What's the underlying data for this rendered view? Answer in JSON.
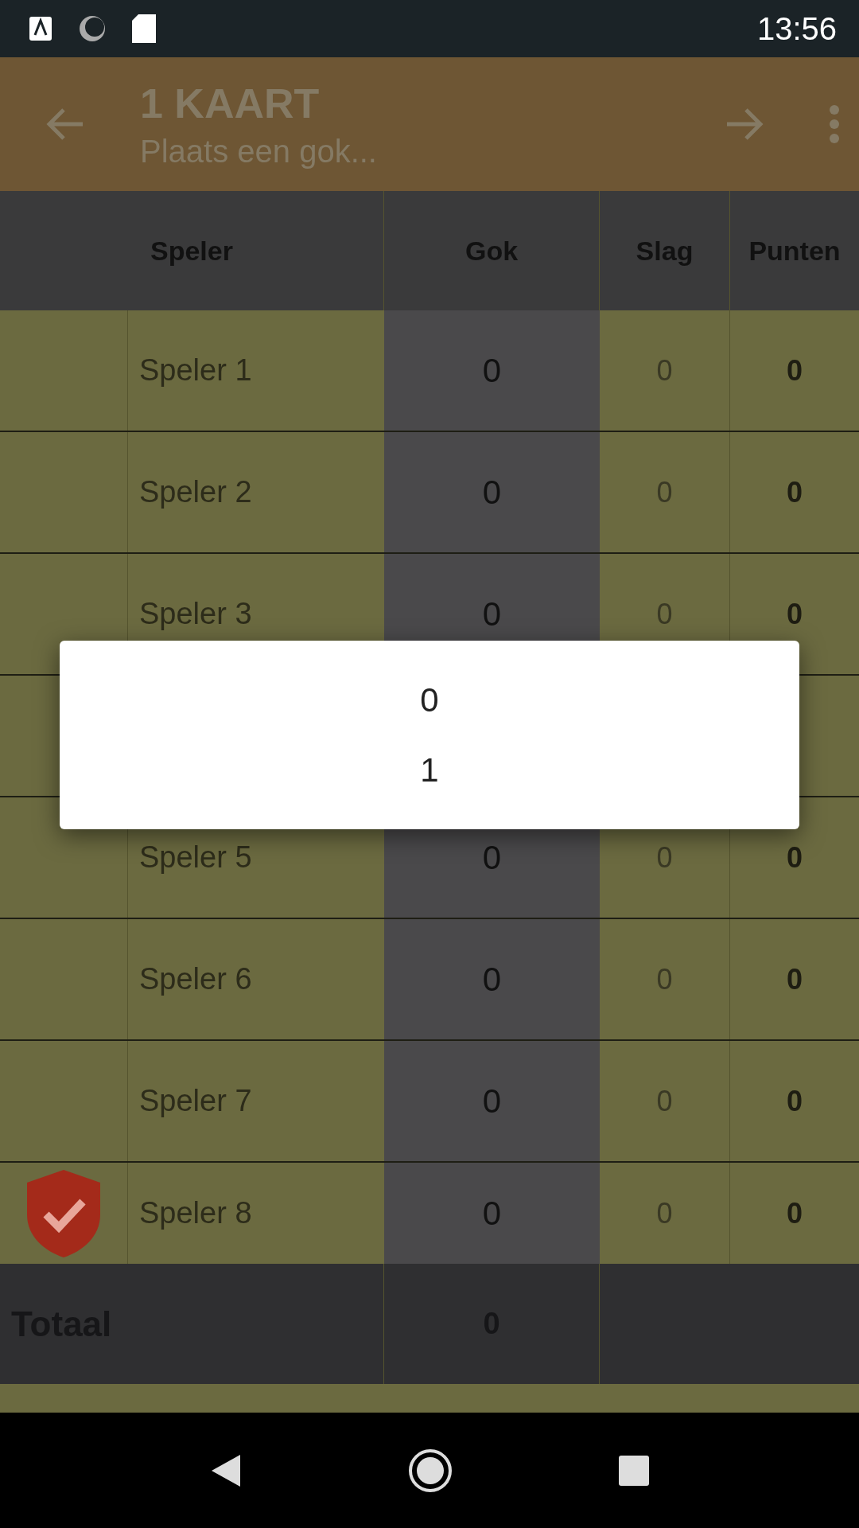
{
  "status_bar": {
    "time": "13:56"
  },
  "app_bar": {
    "title": "1 KAART",
    "subtitle": "Plaats een gok..."
  },
  "table": {
    "columns": [
      "Speler",
      "Gok",
      "Slag",
      "Punten"
    ],
    "rows": [
      {
        "name": "Speler 1",
        "gok": "0",
        "slag": "0",
        "punten": "0",
        "dealer": false
      },
      {
        "name": "Speler 2",
        "gok": "0",
        "slag": "0",
        "punten": "0",
        "dealer": false
      },
      {
        "name": "Speler 3",
        "gok": "0",
        "slag": "0",
        "punten": "0",
        "dealer": false
      },
      {
        "hidden": true
      },
      {
        "name": "Speler 5",
        "gok": "0",
        "slag": "0",
        "punten": "0",
        "dealer": false
      },
      {
        "name": "Speler 6",
        "gok": "0",
        "slag": "0",
        "punten": "0",
        "dealer": false
      },
      {
        "name": "Speler 7",
        "gok": "0",
        "slag": "0",
        "punten": "0",
        "dealer": false
      },
      {
        "name": "Speler 8",
        "gok": "0",
        "slag": "0",
        "punten": "0",
        "dealer": true
      }
    ],
    "total": {
      "label": "Totaal",
      "gok": "0"
    }
  },
  "dialog": {
    "options": [
      "0",
      "1"
    ]
  }
}
